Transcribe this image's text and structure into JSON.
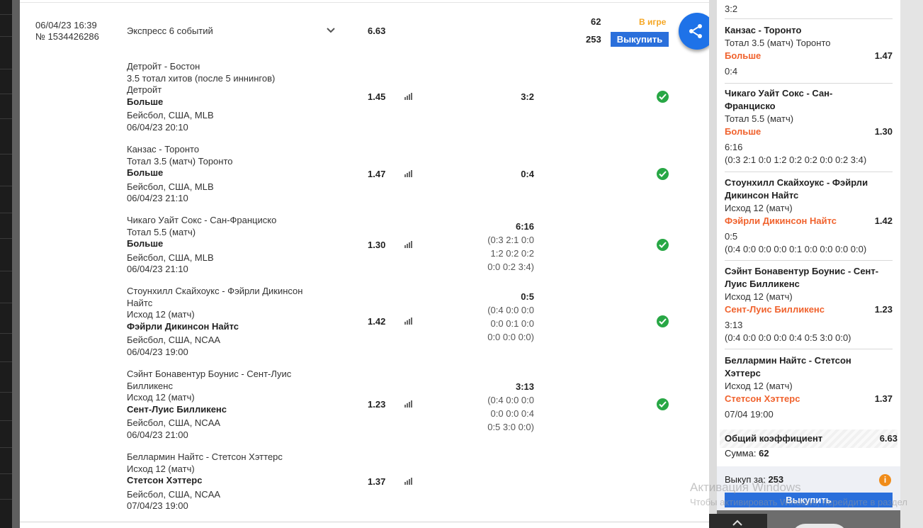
{
  "bet": {
    "date": "06/04/23 16:39",
    "number": "№ 1534426286",
    "title": "Экспресс 6 событий",
    "coef": "6.63",
    "stake": "62",
    "payout": "253",
    "status": "В игре",
    "cashout_label": "Выкупить"
  },
  "events": [
    {
      "teams": "Детройт - Бостон",
      "market": "3.5 тотал хитов (после 5 иннингов) Детройт",
      "pick": "Больше",
      "league": "Бейсбол, США, MLB",
      "time": "06/04/23 20:10",
      "coef": "1.45",
      "score": "3:2",
      "score_detail": "",
      "settled": true
    },
    {
      "teams": "Канзас - Торонто",
      "market": "Тотал 3.5 (матч) Торонто",
      "pick": "Больше",
      "league": "Бейсбол, США, MLB",
      "time": "06/04/23 21:10",
      "coef": "1.47",
      "score": "0:4",
      "score_detail": "",
      "settled": true
    },
    {
      "teams": "Чикаго Уайт Сокс - Сан-Франциско",
      "market": "Тотал 5.5 (матч)",
      "pick": "Больше",
      "league": "Бейсбол, США, MLB",
      "time": "06/04/23 21:10",
      "coef": "1.30",
      "score": "6:16",
      "score_detail": [
        "(0:3 2:1 0:0",
        "1:2 0:2 0:2",
        "0:0 0:2 3:4)"
      ],
      "settled": true
    },
    {
      "teams": "Стоунхилл Скайхоукс - Фэйрли Дикинсон Найтс",
      "market": "Исход 12 (матч)",
      "pick": "Фэйрли Дикинсон Найтс",
      "league": "Бейсбол, США, NCAA",
      "time": "06/04/23 19:00",
      "coef": "1.42",
      "score": "0:5",
      "score_detail": [
        "(0:4 0:0 0:0",
        "0:0 0:1 0:0",
        "0:0 0:0 0:0)"
      ],
      "settled": true
    },
    {
      "teams": "Сэйнт Бонавентур Боунис - Сент-Луис Билликенс",
      "market": "Исход 12 (матч)",
      "pick": "Сент-Луис Билликенс",
      "league": "Бейсбол, США, NCAA",
      "time": "06/04/23 21:00",
      "coef": "1.23",
      "score": "3:13",
      "score_detail": [
        "(0:4 0:0 0:0",
        "0:0 0:0 0:4",
        "0:5 3:0 0:0)"
      ],
      "settled": true
    },
    {
      "teams": "Беллармин Найтс - Стетсон Хэттерс",
      "market": "Исход 12 (матч)",
      "pick": "Стетсон Хэттерс",
      "league": "Бейсбол, США, NCAA",
      "time": "07/04/23 19:00",
      "coef": "1.37",
      "score": "",
      "score_detail": "",
      "settled": false
    }
  ],
  "slip": {
    "top_score": "3:2",
    "items": [
      {
        "teams": [
          "Канзас - Торонто"
        ],
        "market": "Тотал 3.5 (матч) Торонто",
        "pick": "Больше",
        "coef": "1.47",
        "score": "0:4",
        "detail": ""
      },
      {
        "teams": [
          "Чикаго Уайт Сокс - Сан-",
          "Франциско"
        ],
        "market": "Тотал 5.5 (матч)",
        "pick": "Больше",
        "coef": "1.30",
        "score": "6:16",
        "detail": "(0:3 2:1 0:0 1:2 0:2 0:2 0:0 0:2 3:4)"
      },
      {
        "teams": [
          "Стоунхилл Скайхоукс - Фэйрли",
          "Дикинсон Найтс"
        ],
        "market": "Исход 12 (матч)",
        "pick": "Фэйрли Дикинсон Найтс",
        "coef": "1.42",
        "score": "0:5",
        "detail": "(0:4 0:0 0:0 0:0 0:1 0:0 0:0 0:0 0:0)"
      },
      {
        "teams": [
          "Сэйнт Бонавентур Боунис - Сент-",
          "Луис Билликенс"
        ],
        "market": "Исход 12 (матч)",
        "pick": "Сент-Луис Билликенс",
        "coef": "1.23",
        "score": "3:13",
        "detail": "(0:4 0:0 0:0 0:0 0:4 0:5 3:0 0:0)"
      },
      {
        "teams": [
          "Беллармин Найтс - Стетсон",
          "Хэттерс"
        ],
        "market": "Исход 12 (матч)",
        "pick": "Стетсон Хэттерс",
        "coef": "1.37",
        "score": "07/04 19:00",
        "detail": ""
      }
    ],
    "total_label": "Общий коэффициент",
    "total_value": "6.63",
    "sum_label": "Сумма:",
    "sum_value": "62",
    "cashout_label": "Выкуп за:",
    "cashout_value": "253",
    "info_icon": "i",
    "button_label": "Выкупить"
  },
  "watermark": {
    "line1": "Активация Windows",
    "line2": "Чтобы активировать Windows, перейдите в раздел"
  },
  "colors": {
    "accent": "#2a6fdb",
    "status": "#f5a623",
    "pick": "#f0622d",
    "success": "#28a745"
  }
}
